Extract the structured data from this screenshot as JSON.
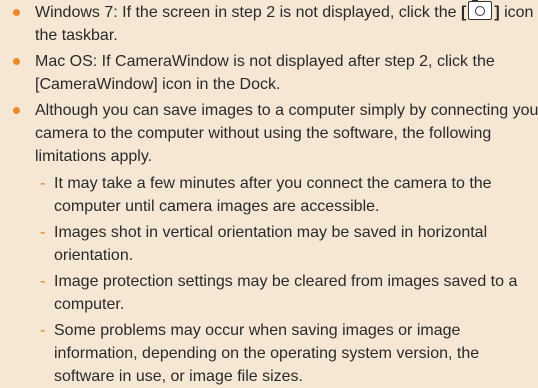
{
  "bullets": [
    {
      "text_before": "Windows 7: If the screen in step 2 is not displayed, click the ",
      "icon_bracket_open": "[",
      "icon_bracket_close": "]",
      "text_after": " icon in the taskbar.",
      "icon": "camerawindow-icon"
    },
    {
      "text": "Mac OS: If CameraWindow is not displayed after step 2, click the [CameraWindow] icon in the Dock."
    },
    {
      "text": "Although you can save images to a computer simply by connecting your camera to the computer without using the software, the following limitations apply."
    }
  ],
  "sub_items": [
    {
      "dash": "-",
      "text": "It may take a few minutes after you connect the camera to the computer until camera images are accessible."
    },
    {
      "dash": "-",
      "text": "Images shot in vertical orientation may be saved in horizontal orientation."
    },
    {
      "dash": "-",
      "text": "Image protection settings may be cleared from images saved to a computer."
    },
    {
      "dash": "-",
      "text": "Some problems may occur when saving images or image information, depending on the operating system version, the software in use, or image file sizes."
    }
  ],
  "colors": {
    "background": "#f5e7d3",
    "bullet": "#ec8a2a",
    "dash": "#e07a1a",
    "text": "#2a2a2a"
  }
}
